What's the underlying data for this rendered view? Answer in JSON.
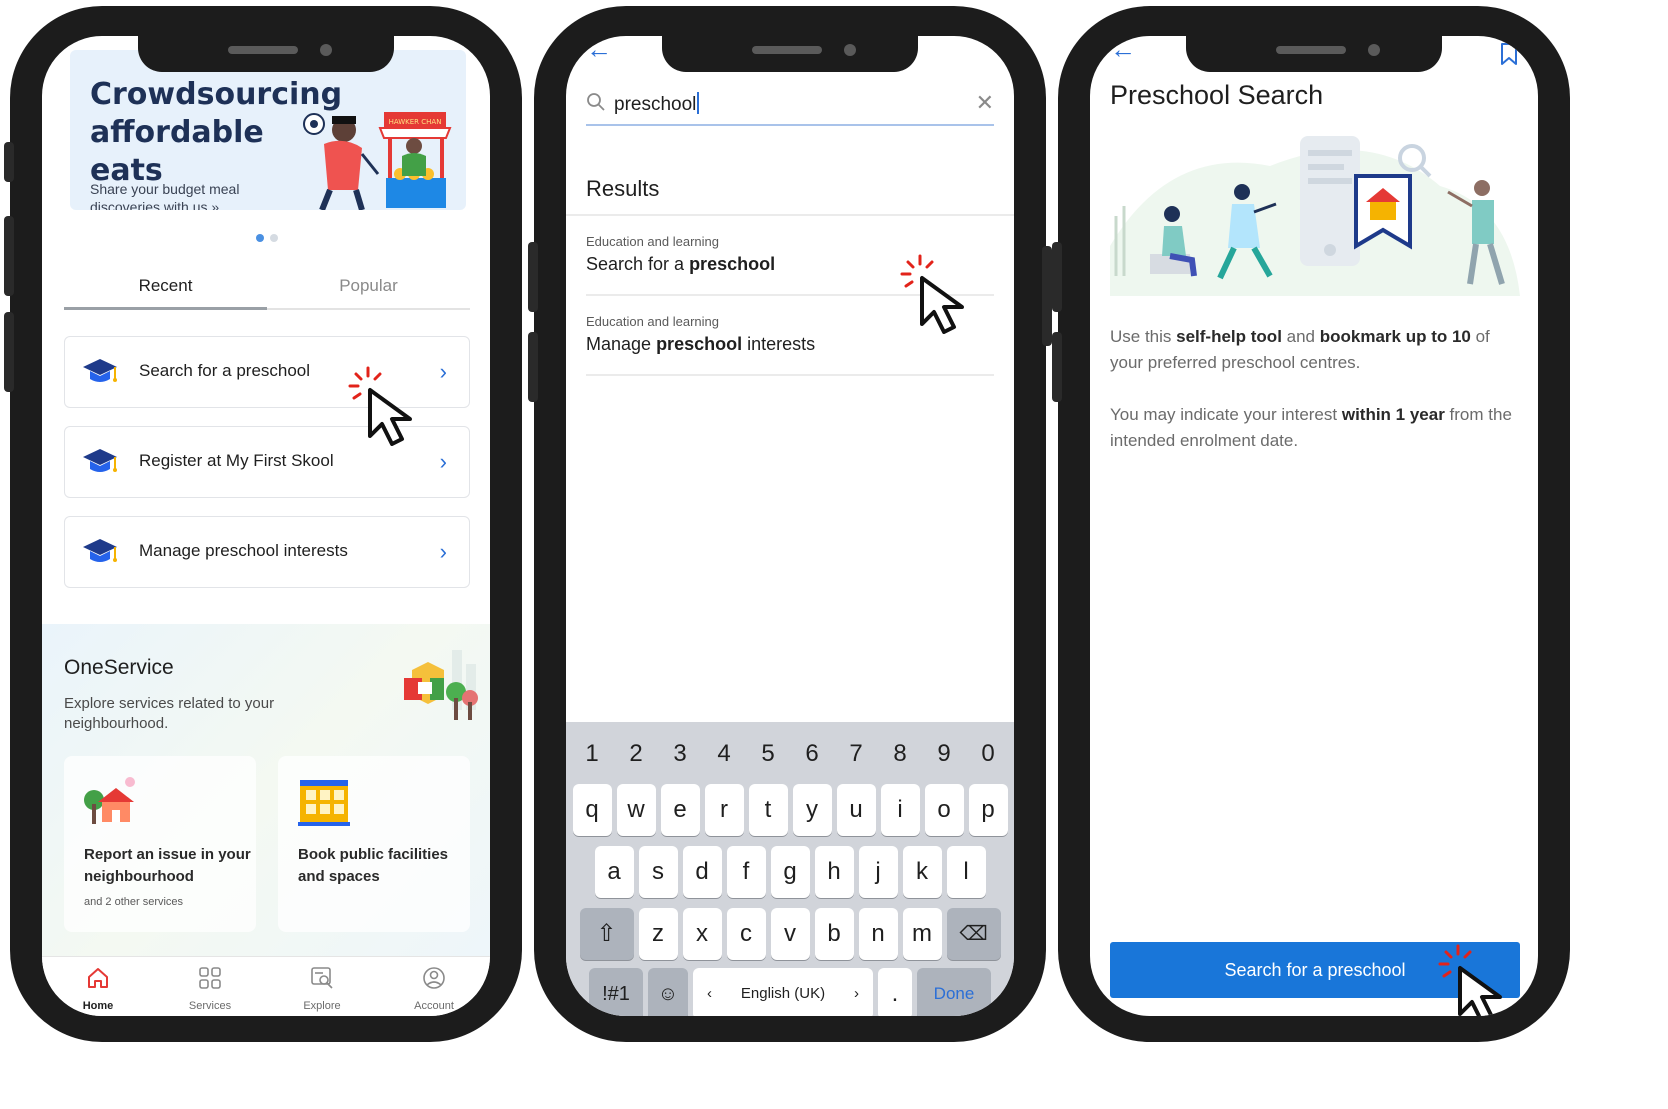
{
  "phone1": {
    "banner": {
      "title": "Crowdsourcing affordable eats",
      "subtitle": "Share your budget meal discoveries with us »",
      "stall_sign": "HAWKER CHAN"
    },
    "carousel": {
      "count": 2,
      "active": 1
    },
    "tabs": [
      {
        "label": "Recent",
        "active": true
      },
      {
        "label": "Popular",
        "active": false
      }
    ],
    "recent_items": [
      {
        "label": "Search for a preschool"
      },
      {
        "label": "Register at My First Skool"
      },
      {
        "label": "Manage preschool interests"
      }
    ],
    "oneservice": {
      "title": "OneService",
      "description": "Explore services related to your neighbourhood."
    },
    "services": [
      {
        "title": "Report an issue in your neighbourhood",
        "subtitle": "and 2 other services"
      },
      {
        "title": "Book public facilities and spaces",
        "subtitle": ""
      }
    ],
    "nav": [
      {
        "label": "Home",
        "icon": "home-icon",
        "active": true
      },
      {
        "label": "Services",
        "icon": "grid-icon",
        "active": false
      },
      {
        "label": "Explore",
        "icon": "explore-icon",
        "active": false
      },
      {
        "label": "Account",
        "icon": "account-icon",
        "active": false
      }
    ]
  },
  "phone2": {
    "search": {
      "value": "preschool"
    },
    "results_heading": "Results",
    "results": [
      {
        "category": "Education and learning",
        "prefix": "Search for a ",
        "highlight": "preschool",
        "suffix": ""
      },
      {
        "category": "Education and learning",
        "prefix": "Manage ",
        "highlight": "preschool",
        "suffix": " interests"
      }
    ],
    "keyboard": {
      "row_numbers": [
        "1",
        "2",
        "3",
        "4",
        "5",
        "6",
        "7",
        "8",
        "9",
        "0"
      ],
      "row1": [
        "q",
        "w",
        "e",
        "r",
        "t",
        "y",
        "u",
        "i",
        "o",
        "p"
      ],
      "row2": [
        "a",
        "s",
        "d",
        "f",
        "g",
        "h",
        "j",
        "k",
        "l"
      ],
      "row3": [
        "z",
        "x",
        "c",
        "v",
        "b",
        "n",
        "m"
      ],
      "symbols_key": "!#1",
      "language": "English (UK)",
      "prev_lang": "‹",
      "next_lang": "›",
      "period": ".",
      "done": "Done"
    }
  },
  "phone3": {
    "title": "Preschool Search",
    "para1": {
      "a": "Use this ",
      "b": "self-help tool",
      "c": " and ",
      "d": "bookmark up to 10",
      "e": " of your preferred preschool centres."
    },
    "para2": {
      "a": "You may indicate your interest ",
      "b": "within 1 year",
      "c": " from the intended enrolment date."
    },
    "cta_label": "Search for a preschool"
  },
  "colors": {
    "accent": "#2b6fd6",
    "cta": "#1976d9",
    "frame": "#1c1c1c"
  }
}
